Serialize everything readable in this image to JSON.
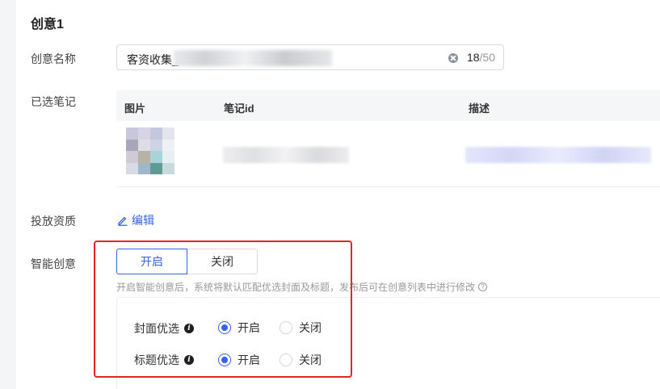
{
  "section": {
    "title": "创意1"
  },
  "name_field": {
    "label": "创意名称",
    "value": "客资收集_",
    "count_current": "18",
    "count_max": "/50"
  },
  "notes": {
    "label": "已选笔记",
    "columns": [
      "图片",
      "笔记id",
      "描述"
    ]
  },
  "qualification": {
    "label": "投放资质",
    "edit_label": "编辑"
  },
  "smart": {
    "label": "智能创意",
    "on_label": "开启",
    "off_label": "关闭",
    "selected": "开启",
    "hint": "开启智能创意后，系统将默认匹配优选封面及标题，发布后可在创意列表中进行修改",
    "options": [
      {
        "label": "封面优选",
        "on_label": "开启",
        "off_label": "关闭",
        "selected": "开启"
      },
      {
        "label": "标题优选",
        "on_label": "开启",
        "off_label": "关闭",
        "selected": "开启"
      }
    ]
  },
  "colors": {
    "accent": "#3761e6",
    "highlight_border": "#e5242a"
  }
}
